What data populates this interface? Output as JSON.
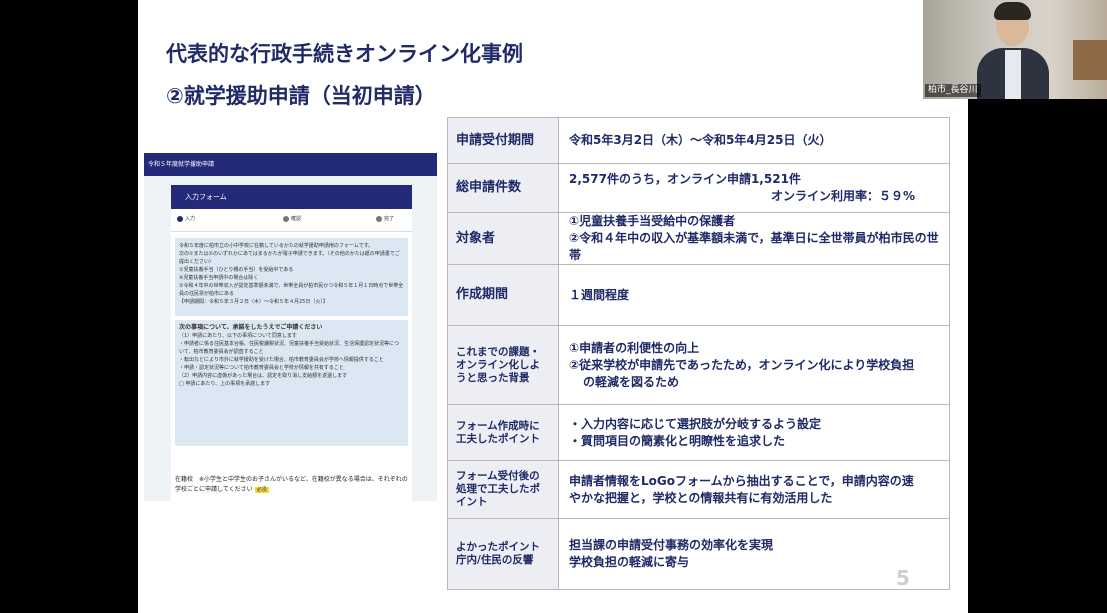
{
  "slide": {
    "title_line1": "代表的な行政手続きオンライン化事例",
    "title_line2": "②就学援助申請（当初申請）",
    "page_number": "5"
  },
  "form_screenshot": {
    "topbar": "令和５年度就学援助申請",
    "card_header": "入力フォーム",
    "steps": [
      "入力",
      "確認",
      "完了"
    ],
    "notice_lines": [
      "令和５年度に柏市立の小中学校に在籍しているかたの就学援助申請用のフォームです。",
      "次の①または②のいずれかにあてはまるかたが電子申請できます。（その他のかたは紙の申請書でご提出ください）",
      "①児童扶養手当（ひとり親の手当）を受給中である",
      "※児童扶養手当申請中の場合は除く",
      "②令和４年中の世帯収入が認定基準額未満で、世帯全員が柏市民かつ令和５年１月１日時点で世帯全員の住民票が柏市にある",
      "【申請期間：令和５年３月２日（木）～令和５年４月25日（火）】"
    ],
    "body_heading": "次の事項について、承諾をしたうえでご申請ください",
    "body_lines": [
      "（1）申請にあたり、以下の事項について同意します",
      "・申請者に係る住民基本台帳、住民税課税状況、児童扶養手当受給状況、生活保護認定状況等について、柏市教育委員会が調査すること",
      "・転出などにより市外に就学援助を受けた場合、柏市教育委員会が学校へ情報提供すること",
      "・申請・認定状況等について柏市教育委員会と学校が情報を共有すること",
      "（2）申請内容に虚偽があった場合は、認定を取り消し支給額を返還します",
      "□ 申請にあたり、上の事項を承諾します"
    ],
    "school_text": "在籍校　※小学生と中学生のお子さんがいるなど、在籍校が異なる場合は、それぞれの学校ごとに申請してください",
    "required_badge": "必須"
  },
  "table": {
    "rows": [
      {
        "label": "申請受付期間",
        "value_lines": [
          "令和5年3月2日（木）～令和5年4月25日（火）"
        ]
      },
      {
        "label": "総申請件数",
        "value_lines": [
          "2,577件のうち，オンライン申請1,521件",
          "オンライン利用率：５９%"
        ]
      },
      {
        "label": "対象者",
        "value_lines": [
          "①児童扶養手当受給中の保護者",
          "②令和４年中の収入が基準額未満で，基準日に全世帯員が柏市民の世帯"
        ]
      },
      {
        "label": "作成期間",
        "value_lines": [
          "１週間程度"
        ]
      },
      {
        "label": "これまでの課題・オンライン化しようと思った背景",
        "value_lines": [
          "①申請者の利便性の向上",
          "②従来学校が申請先であったため，オンライン化により学校負担",
          "の軽減を図るため"
        ]
      },
      {
        "label": "フォーム作成時に工夫したポイント",
        "value_lines": [
          "・入力内容に応じて選択肢が分岐するよう設定",
          "・質問項目の簡素化と明瞭性を追求した"
        ]
      },
      {
        "label": "フォーム受付後の処理で工夫したポイント",
        "value_lines": [
          "申請者情報をLoGoフォームから抽出することで，申請内容の速",
          "やかな把握と，学校との情報共有に有効活用した"
        ]
      },
      {
        "label": "よかったポイント庁内/住民の反響",
        "value_lines": [
          "担当課の申請受付事務の効率化を実現",
          "学校負担の軽減に寄与"
        ]
      }
    ]
  },
  "webcam": {
    "participant_name": "柏市_長谷川"
  }
}
